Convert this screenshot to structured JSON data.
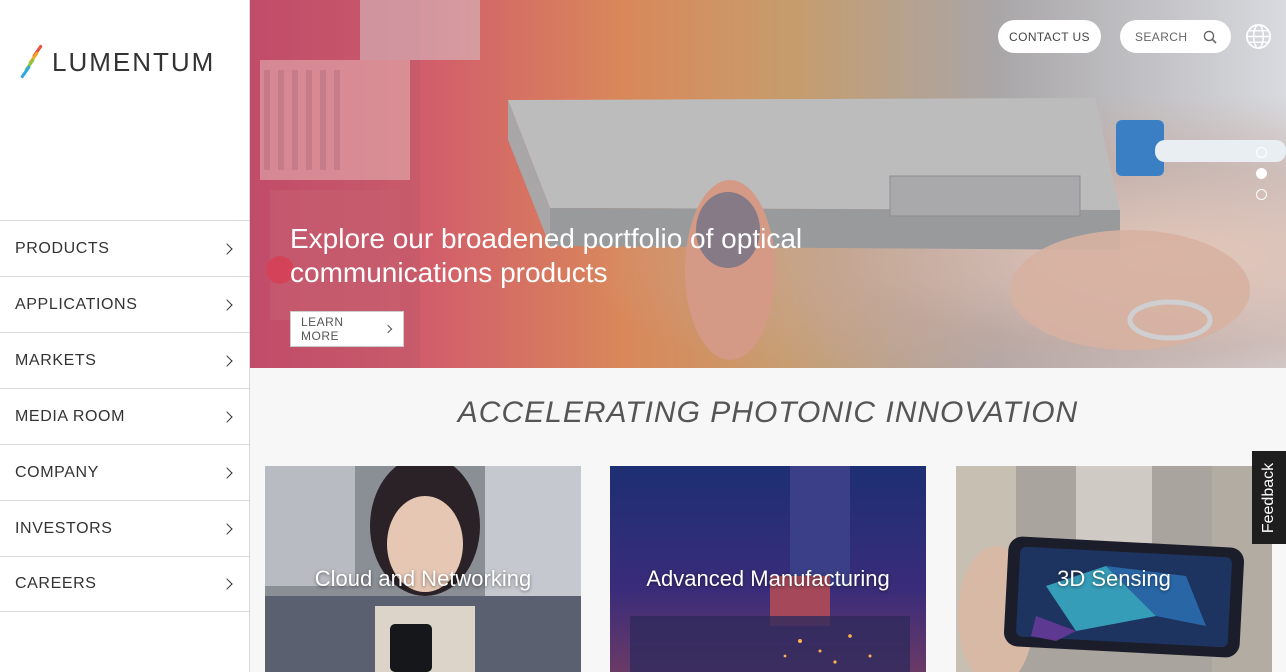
{
  "logo": {
    "text": "LUMENTUM"
  },
  "nav": {
    "items": [
      {
        "label": "PRODUCTS"
      },
      {
        "label": "APPLICATIONS"
      },
      {
        "label": "MARKETS"
      },
      {
        "label": "MEDIA ROOM"
      },
      {
        "label": "COMPANY"
      },
      {
        "label": "INVESTORS"
      },
      {
        "label": "CAREERS"
      }
    ]
  },
  "header": {
    "contact_label": "CONTACT US",
    "search_placeholder": "SEARCH",
    "icons": {
      "search": "search-icon",
      "language": "globe-icon"
    }
  },
  "hero": {
    "title": "Explore our broadened portfolio of optical communications products",
    "cta_label": "LEARN MORE",
    "slides": {
      "count": 3,
      "active_index": 1
    }
  },
  "tagline": "ACCELERATING PHOTONIC INNOVATION",
  "cards": [
    {
      "label": "Cloud and Networking"
    },
    {
      "label": "Advanced Manufacturing"
    },
    {
      "label": "3D Sensing"
    }
  ],
  "feedback_label": "Feedback",
  "colors": {
    "logo_stripes": [
      "#e94e3c",
      "#f5a623",
      "#8cc63f",
      "#29abe2"
    ],
    "hero_gradient_start": "#c6466b",
    "hero_gradient_mid": "#d9885a",
    "text_dark": "#333333"
  }
}
